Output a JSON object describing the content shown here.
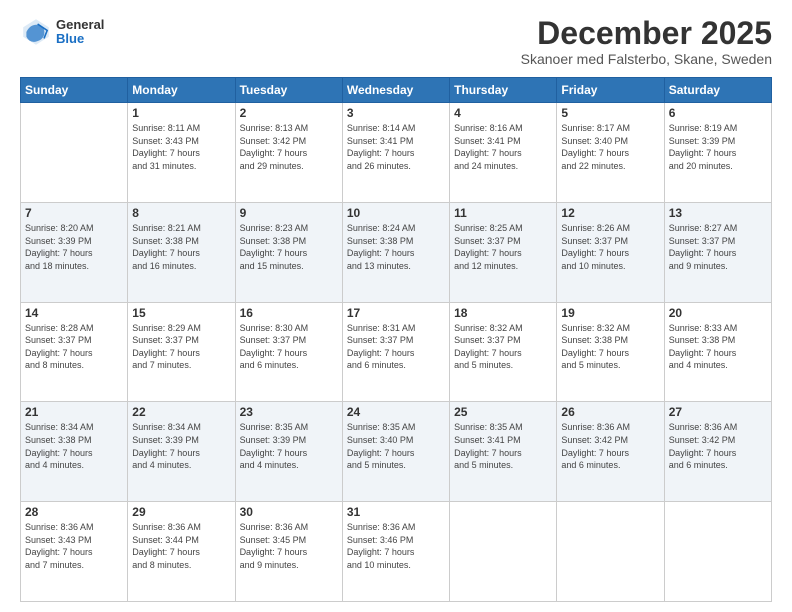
{
  "header": {
    "logo": {
      "general": "General",
      "blue": "Blue"
    },
    "title": "December 2025",
    "subtitle": "Skanoer med Falsterbo, Skane, Sweden"
  },
  "weekdays": [
    "Sunday",
    "Monday",
    "Tuesday",
    "Wednesday",
    "Thursday",
    "Friday",
    "Saturday"
  ],
  "weeks": [
    [
      {
        "day": "",
        "sunrise": "",
        "sunset": "",
        "daylight": ""
      },
      {
        "day": "1",
        "sunrise": "Sunrise: 8:11 AM",
        "sunset": "Sunset: 3:43 PM",
        "daylight": "Daylight: 7 hours and 31 minutes."
      },
      {
        "day": "2",
        "sunrise": "Sunrise: 8:13 AM",
        "sunset": "Sunset: 3:42 PM",
        "daylight": "Daylight: 7 hours and 29 minutes."
      },
      {
        "day": "3",
        "sunrise": "Sunrise: 8:14 AM",
        "sunset": "Sunset: 3:41 PM",
        "daylight": "Daylight: 7 hours and 26 minutes."
      },
      {
        "day": "4",
        "sunrise": "Sunrise: 8:16 AM",
        "sunset": "Sunset: 3:41 PM",
        "daylight": "Daylight: 7 hours and 24 minutes."
      },
      {
        "day": "5",
        "sunrise": "Sunrise: 8:17 AM",
        "sunset": "Sunset: 3:40 PM",
        "daylight": "Daylight: 7 hours and 22 minutes."
      },
      {
        "day": "6",
        "sunrise": "Sunrise: 8:19 AM",
        "sunset": "Sunset: 3:39 PM",
        "daylight": "Daylight: 7 hours and 20 minutes."
      }
    ],
    [
      {
        "day": "7",
        "sunrise": "Sunrise: 8:20 AM",
        "sunset": "Sunset: 3:39 PM",
        "daylight": "Daylight: 7 hours and 18 minutes."
      },
      {
        "day": "8",
        "sunrise": "Sunrise: 8:21 AM",
        "sunset": "Sunset: 3:38 PM",
        "daylight": "Daylight: 7 hours and 16 minutes."
      },
      {
        "day": "9",
        "sunrise": "Sunrise: 8:23 AM",
        "sunset": "Sunset: 3:38 PM",
        "daylight": "Daylight: 7 hours and 15 minutes."
      },
      {
        "day": "10",
        "sunrise": "Sunrise: 8:24 AM",
        "sunset": "Sunset: 3:38 PM",
        "daylight": "Daylight: 7 hours and 13 minutes."
      },
      {
        "day": "11",
        "sunrise": "Sunrise: 8:25 AM",
        "sunset": "Sunset: 3:37 PM",
        "daylight": "Daylight: 7 hours and 12 minutes."
      },
      {
        "day": "12",
        "sunrise": "Sunrise: 8:26 AM",
        "sunset": "Sunset: 3:37 PM",
        "daylight": "Daylight: 7 hours and 10 minutes."
      },
      {
        "day": "13",
        "sunrise": "Sunrise: 8:27 AM",
        "sunset": "Sunset: 3:37 PM",
        "daylight": "Daylight: 7 hours and 9 minutes."
      }
    ],
    [
      {
        "day": "14",
        "sunrise": "Sunrise: 8:28 AM",
        "sunset": "Sunset: 3:37 PM",
        "daylight": "Daylight: 7 hours and 8 minutes."
      },
      {
        "day": "15",
        "sunrise": "Sunrise: 8:29 AM",
        "sunset": "Sunset: 3:37 PM",
        "daylight": "Daylight: 7 hours and 7 minutes."
      },
      {
        "day": "16",
        "sunrise": "Sunrise: 8:30 AM",
        "sunset": "Sunset: 3:37 PM",
        "daylight": "Daylight: 7 hours and 6 minutes."
      },
      {
        "day": "17",
        "sunrise": "Sunrise: 8:31 AM",
        "sunset": "Sunset: 3:37 PM",
        "daylight": "Daylight: 7 hours and 6 minutes."
      },
      {
        "day": "18",
        "sunrise": "Sunrise: 8:32 AM",
        "sunset": "Sunset: 3:37 PM",
        "daylight": "Daylight: 7 hours and 5 minutes."
      },
      {
        "day": "19",
        "sunrise": "Sunrise: 8:32 AM",
        "sunset": "Sunset: 3:38 PM",
        "daylight": "Daylight: 7 hours and 5 minutes."
      },
      {
        "day": "20",
        "sunrise": "Sunrise: 8:33 AM",
        "sunset": "Sunset: 3:38 PM",
        "daylight": "Daylight: 7 hours and 4 minutes."
      }
    ],
    [
      {
        "day": "21",
        "sunrise": "Sunrise: 8:34 AM",
        "sunset": "Sunset: 3:38 PM",
        "daylight": "Daylight: 7 hours and 4 minutes."
      },
      {
        "day": "22",
        "sunrise": "Sunrise: 8:34 AM",
        "sunset": "Sunset: 3:39 PM",
        "daylight": "Daylight: 7 hours and 4 minutes."
      },
      {
        "day": "23",
        "sunrise": "Sunrise: 8:35 AM",
        "sunset": "Sunset: 3:39 PM",
        "daylight": "Daylight: 7 hours and 4 minutes."
      },
      {
        "day": "24",
        "sunrise": "Sunrise: 8:35 AM",
        "sunset": "Sunset: 3:40 PM",
        "daylight": "Daylight: 7 hours and 5 minutes."
      },
      {
        "day": "25",
        "sunrise": "Sunrise: 8:35 AM",
        "sunset": "Sunset: 3:41 PM",
        "daylight": "Daylight: 7 hours and 5 minutes."
      },
      {
        "day": "26",
        "sunrise": "Sunrise: 8:36 AM",
        "sunset": "Sunset: 3:42 PM",
        "daylight": "Daylight: 7 hours and 6 minutes."
      },
      {
        "day": "27",
        "sunrise": "Sunrise: 8:36 AM",
        "sunset": "Sunset: 3:42 PM",
        "daylight": "Daylight: 7 hours and 6 minutes."
      }
    ],
    [
      {
        "day": "28",
        "sunrise": "Sunrise: 8:36 AM",
        "sunset": "Sunset: 3:43 PM",
        "daylight": "Daylight: 7 hours and 7 minutes."
      },
      {
        "day": "29",
        "sunrise": "Sunrise: 8:36 AM",
        "sunset": "Sunset: 3:44 PM",
        "daylight": "Daylight: 7 hours and 8 minutes."
      },
      {
        "day": "30",
        "sunrise": "Sunrise: 8:36 AM",
        "sunset": "Sunset: 3:45 PM",
        "daylight": "Daylight: 7 hours and 9 minutes."
      },
      {
        "day": "31",
        "sunrise": "Sunrise: 8:36 AM",
        "sunset": "Sunset: 3:46 PM",
        "daylight": "Daylight: 7 hours and 10 minutes."
      },
      {
        "day": "",
        "sunrise": "",
        "sunset": "",
        "daylight": ""
      },
      {
        "day": "",
        "sunrise": "",
        "sunset": "",
        "daylight": ""
      },
      {
        "day": "",
        "sunrise": "",
        "sunset": "",
        "daylight": ""
      }
    ]
  ]
}
